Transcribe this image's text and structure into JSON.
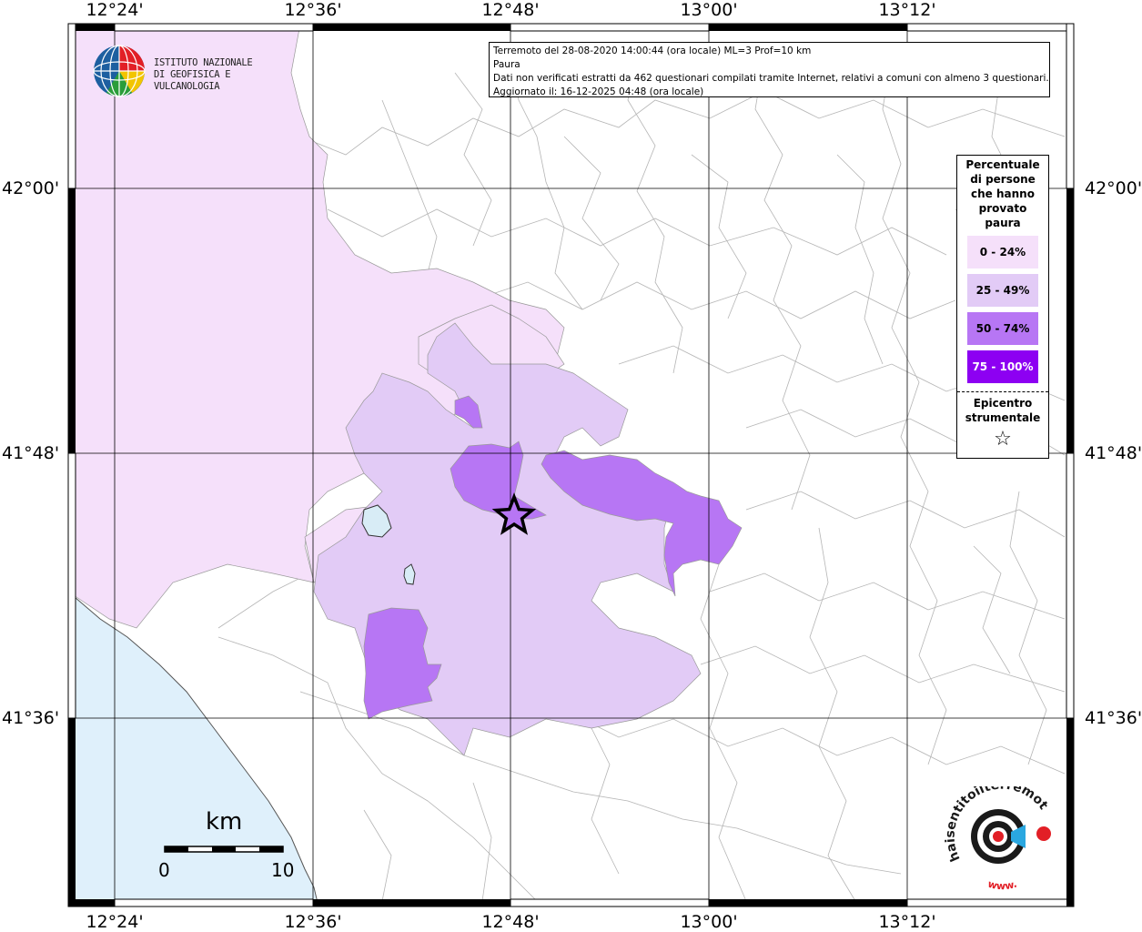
{
  "axes": {
    "lon_labels": [
      "12°24'",
      "12°36'",
      "12°48'",
      "13°00'",
      "13°12'"
    ],
    "lat_labels": [
      "42°00'",
      "41°48'",
      "41°36'"
    ]
  },
  "info": {
    "line1": "Terremoto del 28-08-2020 14:00:44 (ora locale) ML=3 Prof=10 km",
    "line2": "Paura",
    "line3": "Dati non verificati estratti da 462 questionari compilati tramite Internet, relativi a comuni con almeno 3 questionari.",
    "line4": "Aggiornato il: 16-12-2025 04:48 (ora locale)"
  },
  "legend": {
    "title": "Percentuale di persone che hanno provato paura",
    "classes": [
      {
        "label": "0 - 24%",
        "color": "#f5e0fa"
      },
      {
        "label": "25 - 49%",
        "color": "#e2cbf6"
      },
      {
        "label": "50 - 74%",
        "color": "#b776f4"
      },
      {
        "label": "75 - 100%",
        "color": "#8d00f2"
      }
    ],
    "epicenter_label": "Epicentro strumentale",
    "epicenter_symbol": "☆"
  },
  "logo_ingv": {
    "line1": "ISTITUTO NAZIONALE",
    "line2": "DI GEOFISICA E VULCANOLOGIA"
  },
  "scale": {
    "unit": "km",
    "min": "0",
    "max": "10"
  },
  "logo_hst": {
    "text": "haisentitoilterremoto.it",
    "prefix": "www."
  },
  "colors": {
    "sea": "#dff0fb",
    "lake": "#d8ecf6"
  }
}
